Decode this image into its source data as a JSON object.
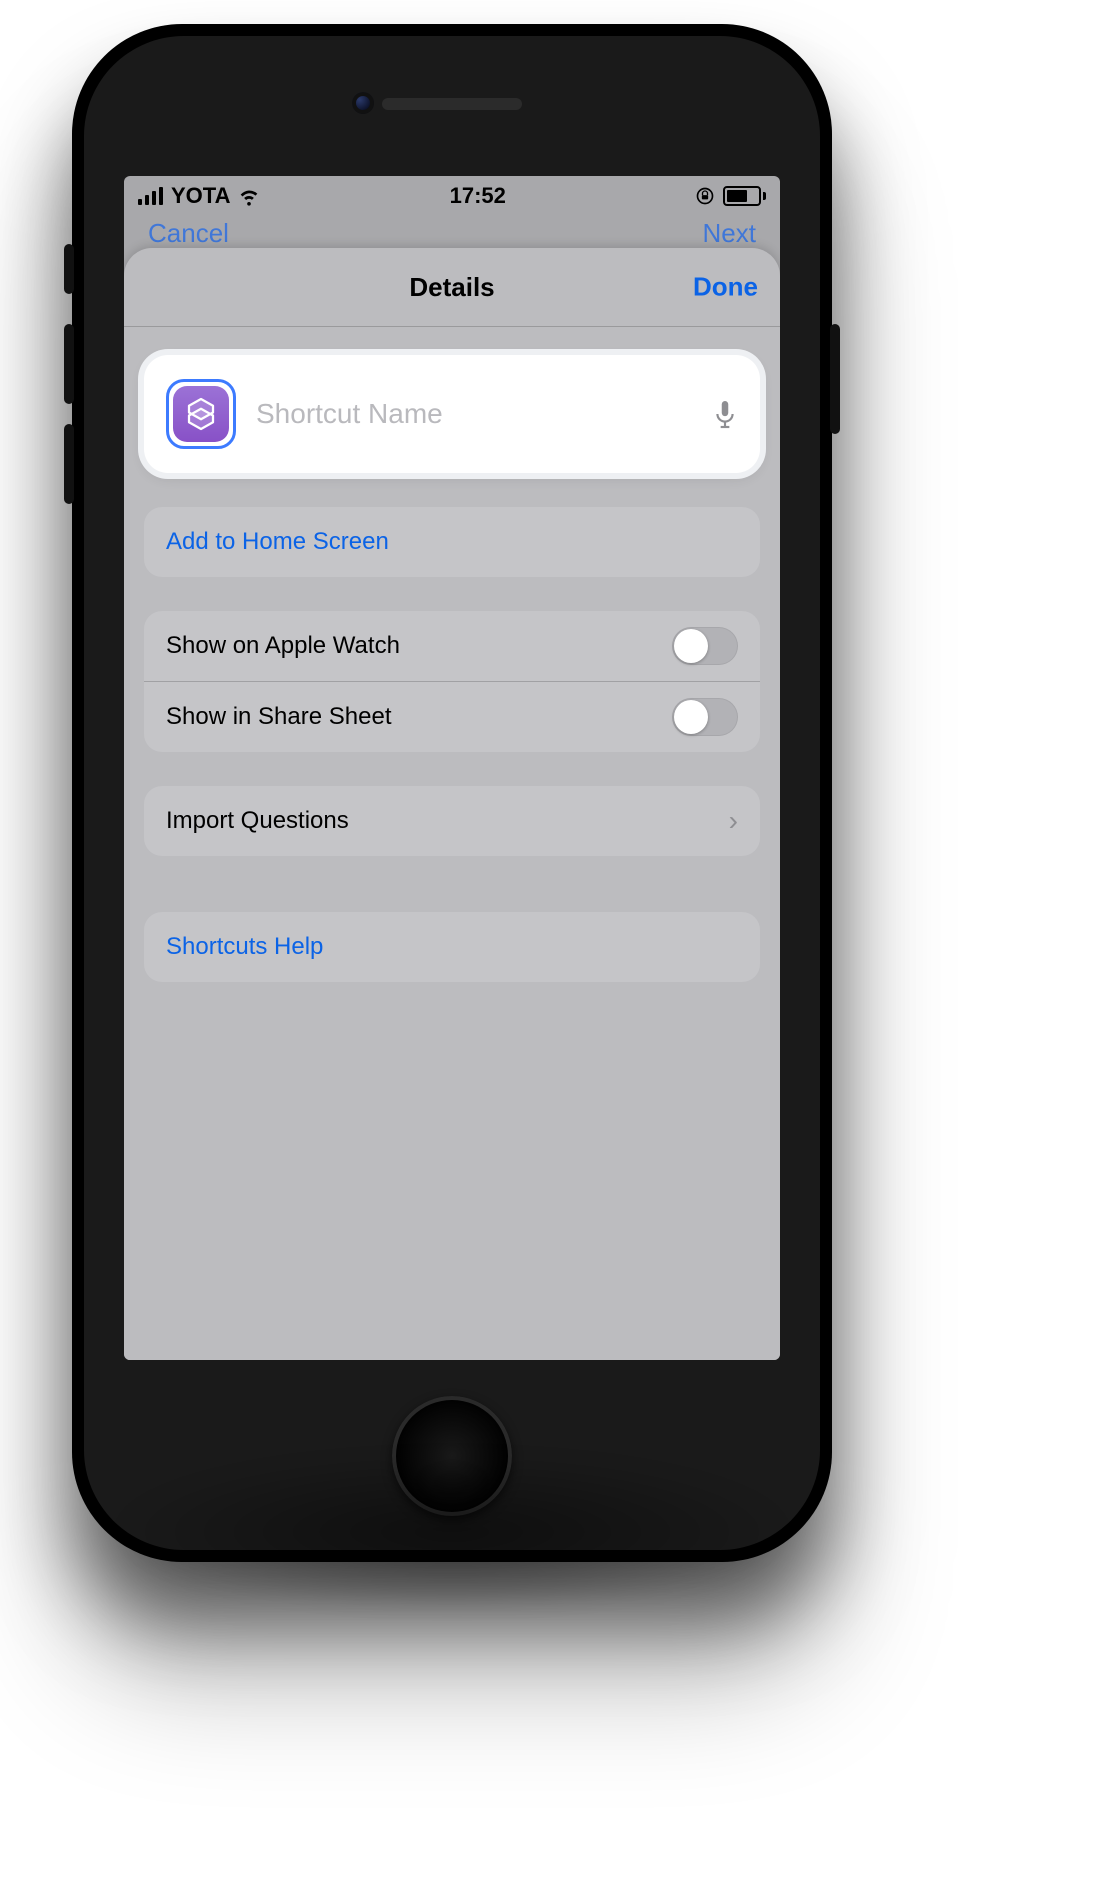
{
  "status": {
    "carrier": "YOTA",
    "time": "17:52"
  },
  "under_nav": {
    "left": "Cancel",
    "right": "Next"
  },
  "sheet": {
    "title": "Details",
    "done": "Done"
  },
  "name_card": {
    "placeholder": "Shortcut Name",
    "value": "",
    "icon": "shortcuts-app-icon"
  },
  "actions": {
    "add_home": "Add to Home Screen"
  },
  "toggles": {
    "apple_watch": {
      "label": "Show on Apple Watch",
      "on": false
    },
    "share_sheet": {
      "label": "Show in Share Sheet",
      "on": false
    }
  },
  "import": {
    "label": "Import Questions"
  },
  "help": {
    "label": "Shortcuts Help"
  }
}
